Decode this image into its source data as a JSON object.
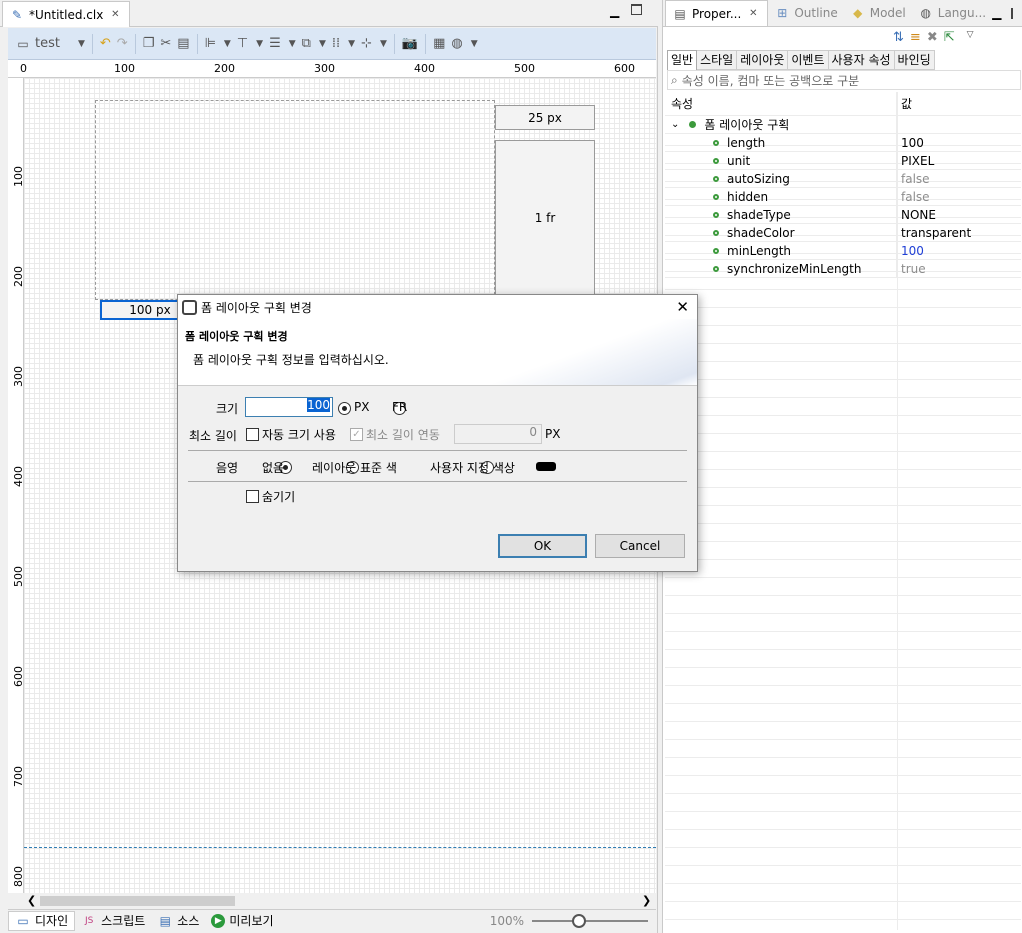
{
  "editor": {
    "tab_title": "*Untitled.clx",
    "toolbar": {
      "app_name": "test"
    },
    "ruler_h": [
      "0",
      "100",
      "200",
      "300",
      "400",
      "500",
      "600"
    ],
    "ruler_v": [
      "100",
      "200",
      "300",
      "400",
      "500",
      "600",
      "700",
      "800"
    ],
    "canvas": {
      "col_header": "25 px",
      "col_fr": "1 fr",
      "row_header": "100 px"
    },
    "bottom_tabs": [
      {
        "label": "디자인"
      },
      {
        "label": "스크립트"
      },
      {
        "label": "소스"
      },
      {
        "label": "미리보기"
      }
    ],
    "zoom": "100%"
  },
  "right_panel": {
    "tabs": [
      {
        "label": "Proper..."
      },
      {
        "label": "Outline"
      },
      {
        "label": "Model"
      },
      {
        "label": "Langu..."
      }
    ],
    "subtabs": [
      "일반",
      "스타일",
      "레이아웃",
      "이벤트",
      "사용자 속성",
      "바인딩"
    ],
    "search_placeholder": "속성 이름, 컴마 또는 공백으로 구분",
    "header_name": "속성",
    "header_value": "값",
    "group_label": "폼 레이아웃 구획",
    "properties": [
      {
        "name": "length",
        "value": "100",
        "color": "#000"
      },
      {
        "name": "unit",
        "value": "PIXEL",
        "color": "#000"
      },
      {
        "name": "autoSizing",
        "value": "false",
        "color": "#8c8c8c"
      },
      {
        "name": "hidden",
        "value": "false",
        "color": "#8c8c8c"
      },
      {
        "name": "shadeType",
        "value": "NONE",
        "color": "#000"
      },
      {
        "name": "shadeColor",
        "value": "transparent",
        "color": "#000"
      },
      {
        "name": "minLength",
        "value": "100",
        "color": "#1f3fd6"
      },
      {
        "name": "synchronizeMinLength",
        "value": "true",
        "color": "#8c8c8c"
      }
    ]
  },
  "dialog": {
    "title": "폼 레이아웃 구획 변경",
    "heading": "폼 레이아웃 구획 변경",
    "description": "폼 레이아웃 구획 정보를 입력하십시오.",
    "size_label": "크기",
    "size_value": "100",
    "unit_px": "PX",
    "unit_fr": "FR",
    "min_label": "최소 길이",
    "auto_size_label": "자동 크기 사용",
    "min_sync_label": "최소 길이 연동",
    "min_value": "0",
    "min_unit": "PX",
    "shade_label": "음영",
    "shade_none": "없음",
    "shade_layout": "레이아웃 표준 색",
    "shade_custom": "사용자 지정 색상",
    "hide_label": "숨기기",
    "ok": "OK",
    "cancel": "Cancel"
  },
  "colors": {
    "accent": "#3c7fb1",
    "toolbar": "#dbe7f5",
    "selection": "#0a64d2"
  }
}
